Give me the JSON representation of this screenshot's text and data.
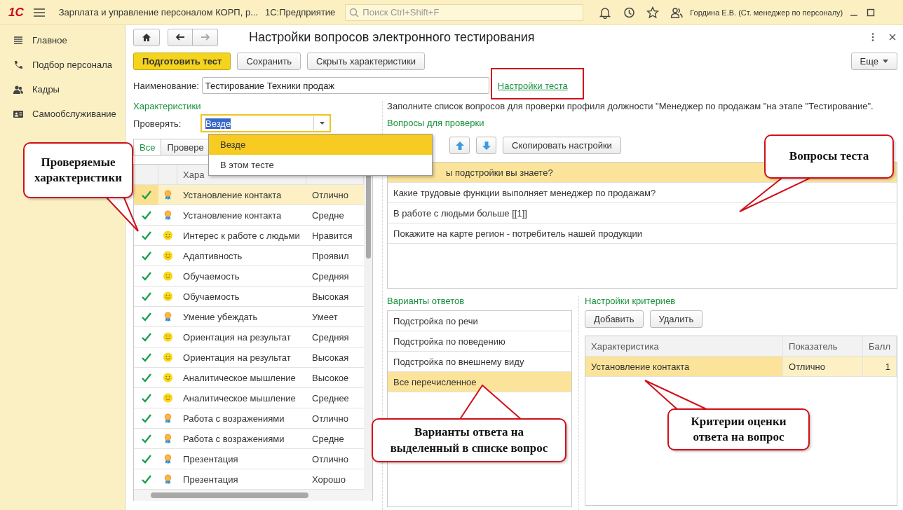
{
  "topbar": {
    "logo": "1С",
    "app_title": "Зарплата и управление персоналом КОРП, р...",
    "platform": "1С:Предприятие",
    "search_placeholder": "Поиск Ctrl+Shift+F",
    "user": "Гордина Е.В. (Ст. менеджер по персоналу)"
  },
  "sidebar": {
    "items": [
      {
        "label": "Главное",
        "kind": "list"
      },
      {
        "label": "Подбор персонала",
        "kind": "phone"
      },
      {
        "label": "Кадры",
        "kind": "people"
      },
      {
        "label": "Самообслуживание",
        "kind": "card"
      }
    ]
  },
  "form": {
    "title": "Настройки вопросов электронного тестирования",
    "buttons": [
      {
        "label": "Подготовить тест",
        "kind": "primary"
      },
      {
        "label": "Сохранить",
        "kind": "normal"
      },
      {
        "label": "Скрыть характеристики",
        "kind": "normal"
      }
    ],
    "more_button": "Еще",
    "name_label": "Наименование:",
    "name_value": "Тестирование Техники продаж",
    "settings_link": "Настройки теста"
  },
  "characteristics": {
    "heading": "Характеристики",
    "check_label": "Проверять:",
    "check_value": "Везде",
    "filters": [
      {
        "label": "Все",
        "selected": true
      },
      {
        "label": "Провере",
        "selected": false
      }
    ],
    "columns": [
      "Хара"
    ],
    "rows": [
      {
        "checked": true,
        "kind": "award",
        "name": "Установление контакта",
        "value": "Отлично",
        "selected": true
      },
      {
        "checked": true,
        "kind": "award",
        "name": "Установление контакта",
        "value": "Средне",
        "selected": false
      },
      {
        "checked": true,
        "kind": "smile",
        "name": "Интерес к работе с людьми",
        "value": "Нравится",
        "selected": false
      },
      {
        "checked": true,
        "kind": "smile",
        "name": "Адаптивность",
        "value": "Проявил",
        "selected": false
      },
      {
        "checked": true,
        "kind": "smile",
        "name": "Обучаемость",
        "value": "Средняя",
        "selected": false
      },
      {
        "checked": true,
        "kind": "smile",
        "name": "Обучаемость",
        "value": "Высокая",
        "selected": false
      },
      {
        "checked": true,
        "kind": "award",
        "name": "Умение убеждать",
        "value": "Умеет",
        "selected": false
      },
      {
        "checked": true,
        "kind": "smile",
        "name": "Ориентация на результат",
        "value": "Средняя",
        "selected": false
      },
      {
        "checked": true,
        "kind": "smile",
        "name": "Ориентация на результат",
        "value": "Высокая",
        "selected": false
      },
      {
        "checked": true,
        "kind": "smile",
        "name": "Аналитическое мышление",
        "value": "Высокое",
        "selected": false
      },
      {
        "checked": true,
        "kind": "smile",
        "name": "Аналитическое мышление",
        "value": "Среднее",
        "selected": false
      },
      {
        "checked": true,
        "kind": "award",
        "name": "Работа с возражениями",
        "value": "Отлично",
        "selected": false
      },
      {
        "checked": true,
        "kind": "award",
        "name": "Работа с возражениями",
        "value": "Средне",
        "selected": false
      },
      {
        "checked": true,
        "kind": "award",
        "name": "Презентация",
        "value": "Отлично",
        "selected": false
      },
      {
        "checked": true,
        "kind": "award",
        "name": "Презентация",
        "value": "Хорошо",
        "selected": false
      }
    ]
  },
  "dropdown": {
    "options": [
      {
        "label": "Везде",
        "selected": true
      },
      {
        "label": "В этом тесте",
        "selected": false
      }
    ]
  },
  "questions": {
    "instruction": "Заполните список вопросов для проверки профиля должности \"Менеджер по продажам \"на этапе \"Тестирование\".",
    "heading": "Вопросы для проверки",
    "copy_button": "Скопировать настройки",
    "rows": [
      {
        "text": "ы подстройки вы знаете?",
        "selected": true
      },
      {
        "text": "Какие трудовые функции выполняет менеджер по продажам?",
        "selected": false
      },
      {
        "text": "В работе с людьми больше [[1]]",
        "selected": false
      },
      {
        "text": "Покажите на карте регион - потребитель нашей продукции",
        "selected": false
      }
    ]
  },
  "answers": {
    "heading": "Варианты ответов",
    "rows": [
      {
        "text": "Подстройка по речи",
        "selected": false
      },
      {
        "text": "Подстройка по поведению",
        "selected": false
      },
      {
        "text": "Подстройка по внешнему виду",
        "selected": false
      },
      {
        "text": "Все перечисленное",
        "selected": true
      }
    ]
  },
  "criteria": {
    "heading": "Настройки критериев",
    "buttons": [
      "Добавить",
      "Удалить"
    ],
    "columns": [
      "Характеристика",
      "Показатель",
      "Балл"
    ],
    "rows": [
      {
        "characteristic": "Установление контакта",
        "indicator": "Отлично",
        "score": "1",
        "selected": true
      }
    ]
  },
  "callouts": [
    {
      "text": "Проверяемые характеристики"
    },
    {
      "text": "Вопросы теста"
    },
    {
      "text": "Варианты ответа на выделенный в списке вопрос"
    },
    {
      "text": "Критерии оценки ответа на вопрос"
    }
  ]
}
